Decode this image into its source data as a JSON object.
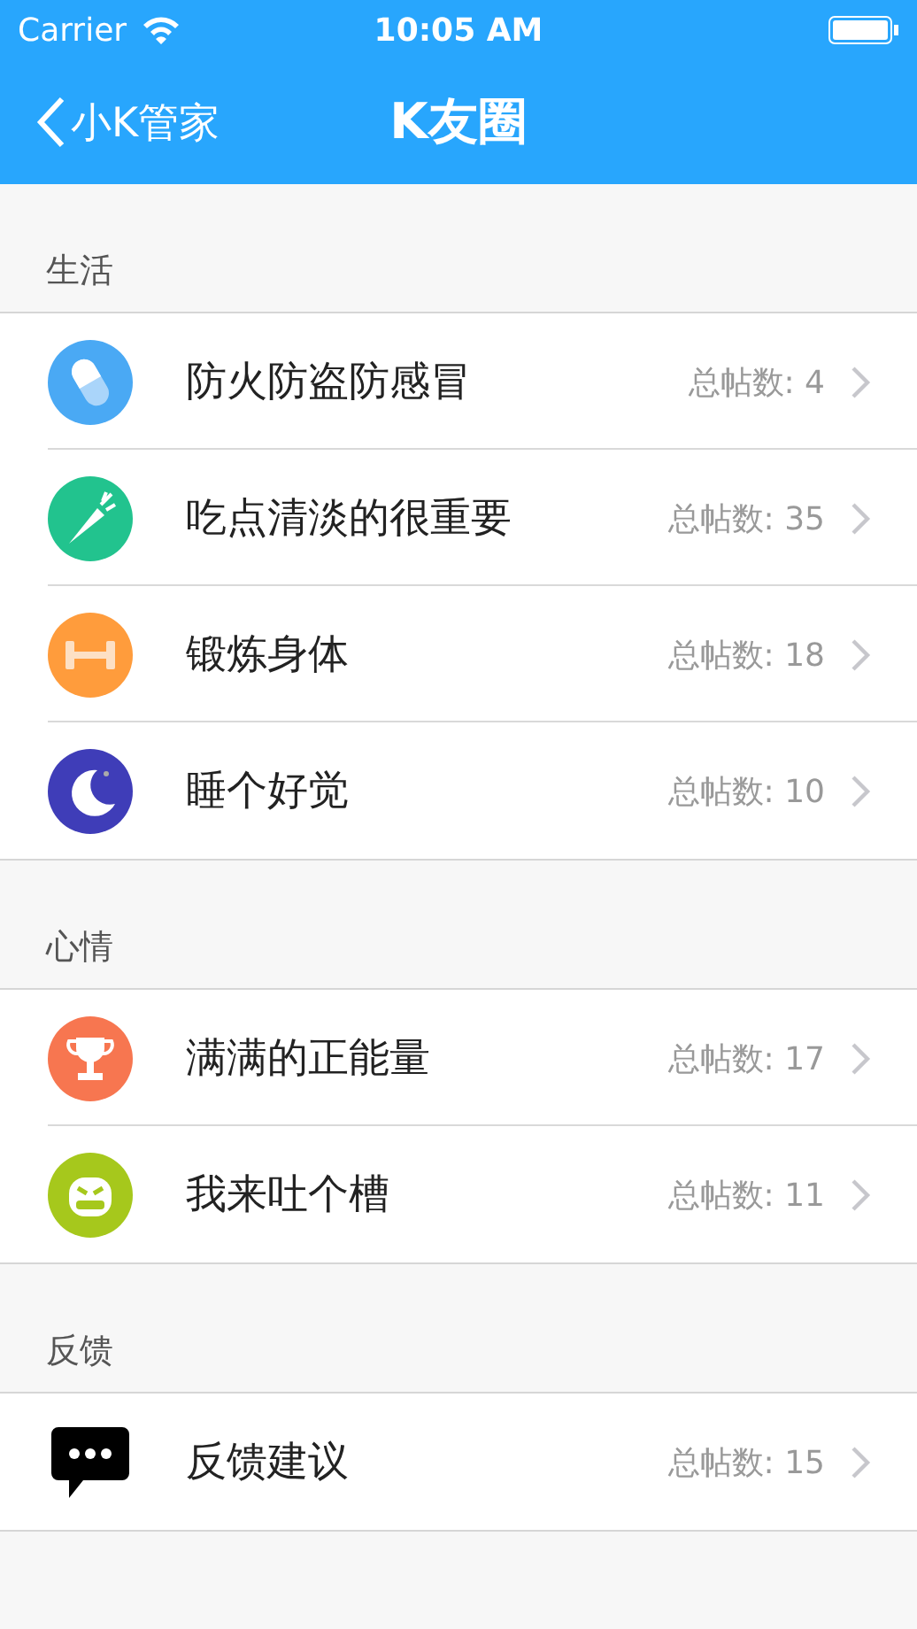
{
  "status_bar": {
    "carrier": "Carrier",
    "time": "10:05 AM"
  },
  "nav": {
    "back": "小K管家",
    "title": "K友圈"
  },
  "sections": [
    {
      "title": "生活",
      "items": [
        {
          "kind": "pill",
          "label": "防火防盗防感冒",
          "count": "总帖数: 4"
        },
        {
          "kind": "carrot",
          "label": "吃点清淡的很重要",
          "count": "总帖数: 35"
        },
        {
          "kind": "dumbbell",
          "label": "锻炼身体",
          "count": "总帖数: 18"
        },
        {
          "kind": "moon",
          "label": "睡个好觉",
          "count": "总帖数: 10"
        }
      ]
    },
    {
      "title": "心情",
      "items": [
        {
          "kind": "trophy",
          "label": "满满的正能量",
          "count": "总帖数: 17"
        },
        {
          "kind": "face",
          "label": "我来吐个槽",
          "count": "总帖数: 11"
        }
      ]
    },
    {
      "title": "反馈",
      "items": [
        {
          "kind": "chat",
          "label": "反馈建议",
          "count": "总帖数: 15"
        }
      ]
    }
  ]
}
